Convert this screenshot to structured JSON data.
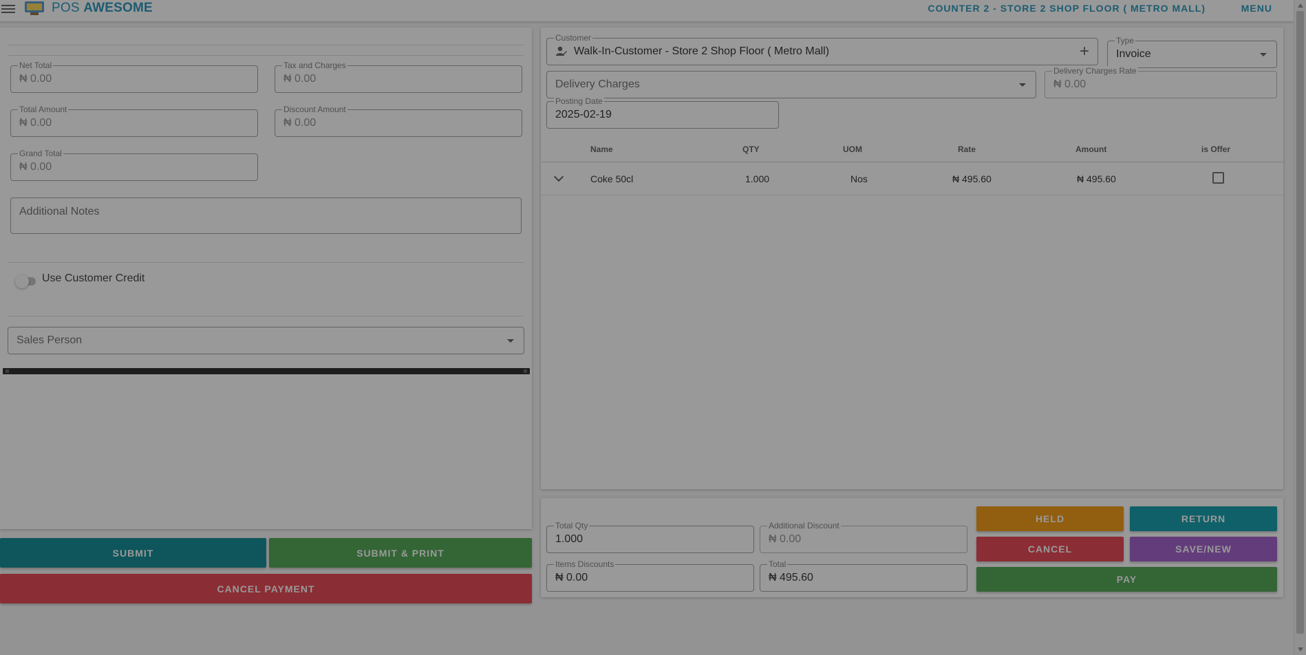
{
  "header": {
    "brand_prefix": "POS ",
    "brand_bold": "AWESOME",
    "store": "COUNTER 2 - STORE 2 SHOP FLOOR ( METRO MALL)",
    "menu": "MENU"
  },
  "payment": {
    "net_total": {
      "label": "Net Total",
      "value": "₦ 0.00"
    },
    "tax": {
      "label": "Tax and Charges",
      "value": "₦ 0.00"
    },
    "total_amount": {
      "label": "Total Amount",
      "value": "₦ 0.00"
    },
    "discount_amount": {
      "label": "Discount Amount",
      "value": "₦ 0.00"
    },
    "grand_total": {
      "label": "Grand Total",
      "value": "₦ 0.00"
    },
    "notes_placeholder": "Additional Notes",
    "credit_label": "Use Customer Credit",
    "sales_person_placeholder": "Sales Person",
    "submit": "SUBMIT",
    "submit_print": "SUBMIT & PRINT",
    "cancel_payment": "CANCEL PAYMENT"
  },
  "invoice": {
    "customer_label": "Customer",
    "customer_value": "Walk-In-Customer - Store 2  Shop Floor  ( Metro Mall)",
    "type_label": "Type",
    "type_value": "Invoice",
    "delivery_placeholder": "Delivery Charges",
    "delivery_rate_label": "Delivery Charges Rate",
    "delivery_rate_value": "₦ 0.00",
    "posting_label": "Posting Date",
    "posting_value": "2025-02-19"
  },
  "table": {
    "headers": {
      "name": "Name",
      "qty": "QTY",
      "uom": "UOM",
      "rate": "Rate",
      "amount": "Amount",
      "offer": "is Offer"
    },
    "rows": [
      {
        "name": "Coke 50cl",
        "qty": "1.000",
        "uom": "Nos",
        "rate": "₦ 495.60",
        "amount": "₦ 495.60",
        "is_offer": false
      }
    ]
  },
  "summary": {
    "total_qty": {
      "label": "Total Qty",
      "value": "1.000"
    },
    "additional_discount": {
      "label": "Additional Discount",
      "value": "₦ 0.00"
    },
    "items_discounts": {
      "label": "Items Discounts",
      "value": "₦ 0.00"
    },
    "total": {
      "label": "Total",
      "value": "₦ 495.60"
    },
    "held": "HELD",
    "return": "RETURN",
    "cancel": "CANCEL",
    "save_new": "SAVE/NEW",
    "pay": "PAY"
  },
  "colors": {
    "primary": "#0097a7",
    "submit": "#00838f",
    "success": "#43a047",
    "danger": "#e53945",
    "warning": "#f39200",
    "purple": "#9c56c8",
    "link": "#1a8fb5"
  }
}
